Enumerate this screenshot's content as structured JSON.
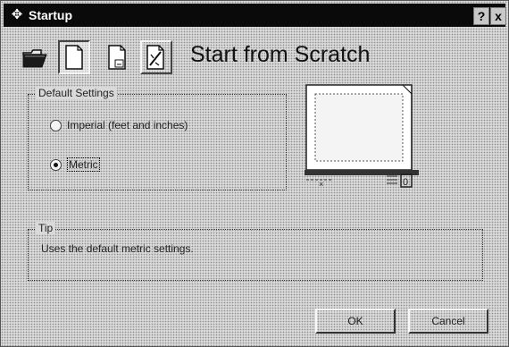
{
  "window": {
    "title": "Startup",
    "help_label": "?",
    "close_label": "x"
  },
  "toolbar": {
    "items": [
      {
        "name": "open-drawing",
        "icon": "open-folder-icon",
        "state": "normal"
      },
      {
        "name": "start-from-scratch",
        "icon": "blank-page-icon",
        "state": "pressed"
      },
      {
        "name": "use-template",
        "icon": "template-page-icon",
        "state": "normal"
      },
      {
        "name": "use-wizard",
        "icon": "wizard-page-icon",
        "state": "normal"
      }
    ],
    "heading": "Start from Scratch"
  },
  "default_settings": {
    "label": "Default Settings",
    "options": [
      {
        "label": "Imperial (feet and inches)",
        "selected": false
      },
      {
        "label": "Metric",
        "selected": true
      }
    ]
  },
  "preview": {
    "x_marker": "×",
    "dim_marker": "0"
  },
  "tip": {
    "label": "Tip",
    "text": "Uses the default metric settings."
  },
  "buttons": {
    "ok": "OK",
    "cancel": "Cancel"
  }
}
